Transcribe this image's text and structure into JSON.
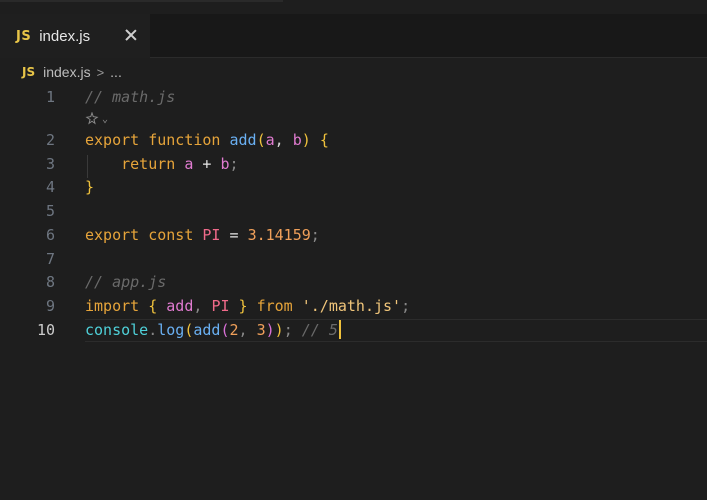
{
  "tab": {
    "icon": "JS",
    "label": "index.js",
    "close_icon": "close-icon"
  },
  "breadcrumb": {
    "icon": "JS",
    "file": "index.js",
    "separator": ">",
    "more": "..."
  },
  "editor": {
    "lines": [
      {
        "num": "1",
        "tokens": [
          {
            "t": "// math.js",
            "c": "cm"
          }
        ]
      },
      {
        "num": "2",
        "tokens": [
          {
            "t": "export",
            "c": "kw"
          },
          {
            "t": " ",
            "c": "tx"
          },
          {
            "t": "function",
            "c": "kw"
          },
          {
            "t": " ",
            "c": "tx"
          },
          {
            "t": "add",
            "c": "fn"
          },
          {
            "t": "(",
            "c": "br1"
          },
          {
            "t": "a",
            "c": "pm"
          },
          {
            "t": ", ",
            "c": "tx"
          },
          {
            "t": "b",
            "c": "pm"
          },
          {
            "t": ")",
            "c": "br1"
          },
          {
            "t": " ",
            "c": "tx"
          },
          {
            "t": "{",
            "c": "br1"
          }
        ]
      },
      {
        "num": "3",
        "tokens": [
          {
            "t": "    ",
            "c": "tx"
          },
          {
            "t": "return",
            "c": "kw"
          },
          {
            "t": " ",
            "c": "tx"
          },
          {
            "t": "a",
            "c": "pm"
          },
          {
            "t": " + ",
            "c": "op"
          },
          {
            "t": "b",
            "c": "pm"
          },
          {
            "t": ";",
            "c": "punc"
          }
        ]
      },
      {
        "num": "4",
        "tokens": [
          {
            "t": "}",
            "c": "br1"
          }
        ]
      },
      {
        "num": "5",
        "tokens": []
      },
      {
        "num": "6",
        "tokens": [
          {
            "t": "export",
            "c": "kw"
          },
          {
            "t": " ",
            "c": "tx"
          },
          {
            "t": "const",
            "c": "kw"
          },
          {
            "t": " ",
            "c": "tx"
          },
          {
            "t": "PI",
            "c": "cst"
          },
          {
            "t": " = ",
            "c": "op"
          },
          {
            "t": "3.14159",
            "c": "num"
          },
          {
            "t": ";",
            "c": "punc"
          }
        ]
      },
      {
        "num": "7",
        "tokens": []
      },
      {
        "num": "8",
        "tokens": [
          {
            "t": "// app.js",
            "c": "cm"
          }
        ]
      },
      {
        "num": "9",
        "tokens": [
          {
            "t": "import",
            "c": "kw"
          },
          {
            "t": " ",
            "c": "tx"
          },
          {
            "t": "{",
            "c": "br1"
          },
          {
            "t": " ",
            "c": "tx"
          },
          {
            "t": "add",
            "c": "pm"
          },
          {
            "t": ", ",
            "c": "punc"
          },
          {
            "t": "PI",
            "c": "cst"
          },
          {
            "t": " ",
            "c": "tx"
          },
          {
            "t": "}",
            "c": "br1"
          },
          {
            "t": " ",
            "c": "tx"
          },
          {
            "t": "from",
            "c": "kw"
          },
          {
            "t": " ",
            "c": "tx"
          },
          {
            "t": "'./math.js'",
            "c": "str"
          },
          {
            "t": ";",
            "c": "punc"
          }
        ]
      },
      {
        "num": "10",
        "active": true,
        "tokens": [
          {
            "t": "console",
            "c": "obj"
          },
          {
            "t": ".",
            "c": "punc"
          },
          {
            "t": "log",
            "c": "fn"
          },
          {
            "t": "(",
            "c": "br1"
          },
          {
            "t": "add",
            "c": "fn"
          },
          {
            "t": "(",
            "c": "br2"
          },
          {
            "t": "2",
            "c": "num"
          },
          {
            "t": ", ",
            "c": "punc"
          },
          {
            "t": "3",
            "c": "num"
          },
          {
            "t": ")",
            "c": "br2"
          },
          {
            "t": ")",
            "c": "br1"
          },
          {
            "t": ";",
            "c": "punc"
          },
          {
            "t": " // 5",
            "c": "ghost"
          }
        ]
      }
    ]
  },
  "codelens": {
    "icon": "sparkle-icon",
    "chevron": "chevron-down-icon"
  },
  "colors": {
    "background": "#1e1e1e",
    "tab_bar": "#181818",
    "js_icon": "#e8c548",
    "cursor": "#f0c23c"
  }
}
